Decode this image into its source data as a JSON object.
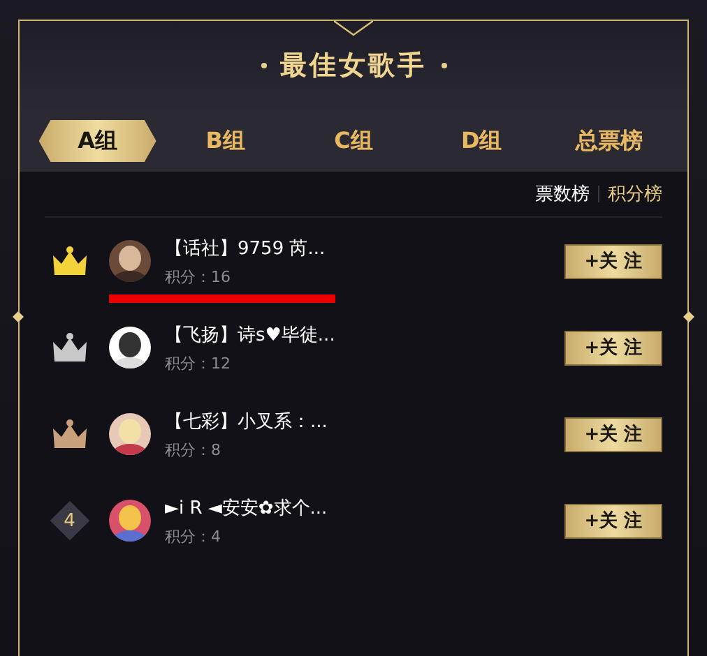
{
  "title": "最佳女歌手",
  "tabs": [
    {
      "label": "A组",
      "selected": true
    },
    {
      "label": "B组",
      "selected": false
    },
    {
      "label": "C组",
      "selected": false
    },
    {
      "label": "D组",
      "selected": false
    },
    {
      "label": "总票榜",
      "selected": false
    }
  ],
  "sort_tabs": [
    {
      "label": "票数榜",
      "selected": false
    },
    {
      "label": "积分榜",
      "selected": true
    }
  ],
  "rows": [
    {
      "kind": "crown",
      "color": "#f2d43a",
      "name": "【话社】9759 芮...",
      "score": "积分：16",
      "underlined": true,
      "follow": "+关 注"
    },
    {
      "kind": "crown",
      "color": "#c8c8c8",
      "name": "【飞扬】诗s♥毕徒...",
      "score": "积分：12",
      "underlined": false,
      "follow": "+关 注"
    },
    {
      "kind": "crown",
      "color": "#c9a07a",
      "name": "【七彩】小叉系：...",
      "score": "积分：8",
      "underlined": false,
      "follow": "+关 注"
    },
    {
      "kind": "number",
      "rank": "4",
      "name": "►i R ◄安安✿求个...",
      "score": "积分：4",
      "underlined": false,
      "follow": "+关 注"
    }
  ]
}
